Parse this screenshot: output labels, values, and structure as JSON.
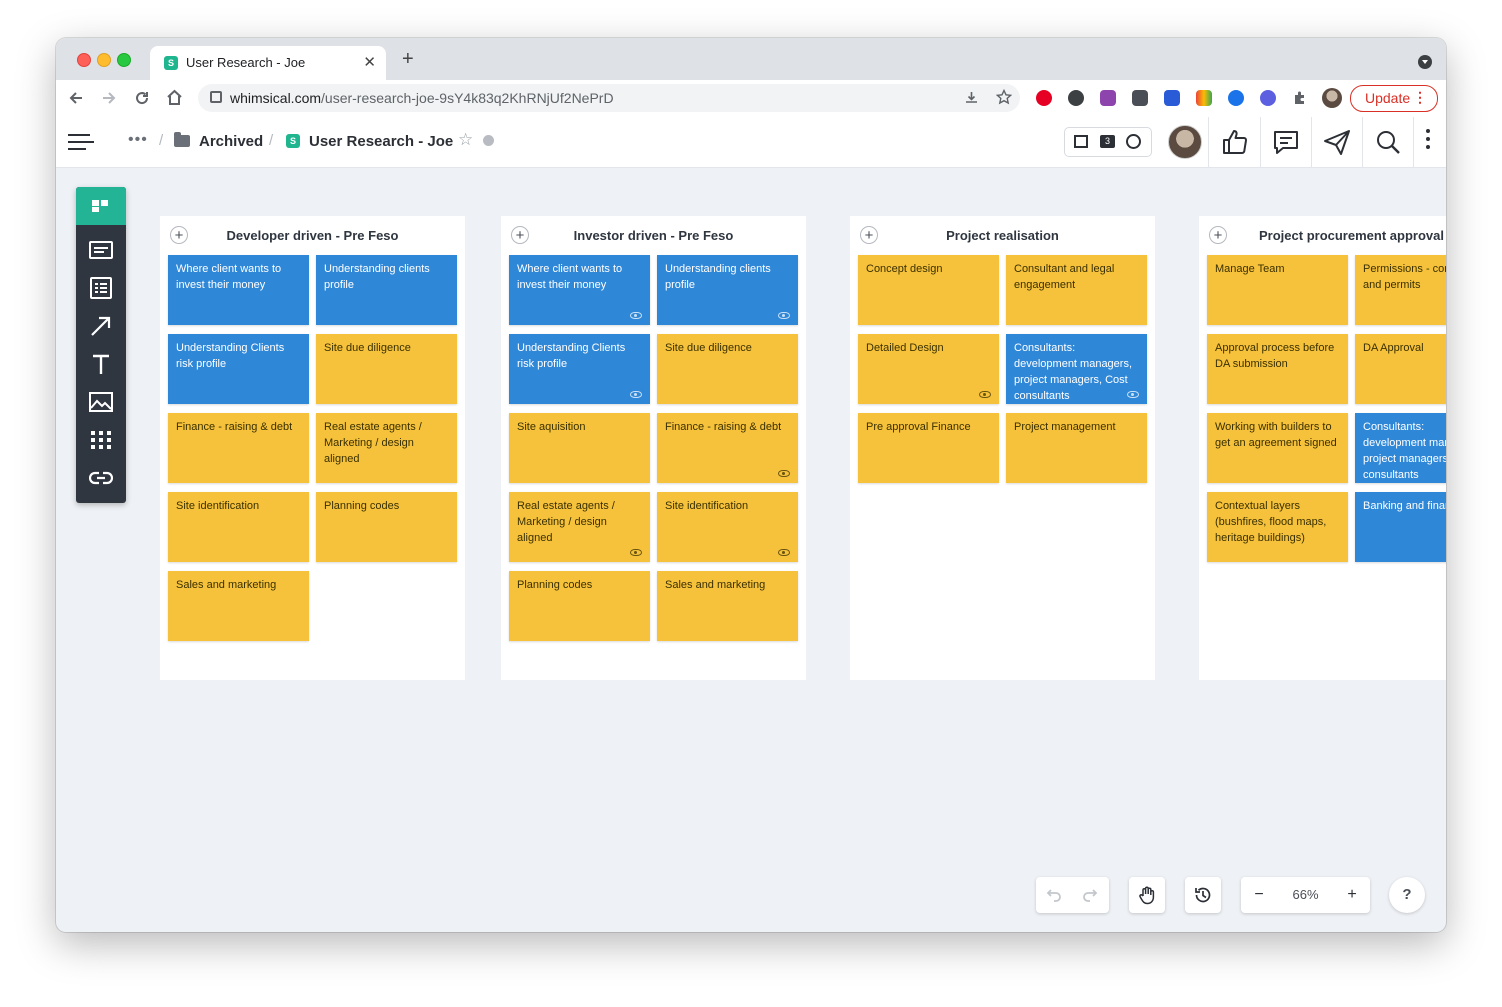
{
  "browser": {
    "tab_title": "User Research - Joe",
    "tab_favicon_letter": "S",
    "close_glyph": "✕",
    "new_tab_glyph": "+",
    "url_domain": "whimsical.com",
    "url_path": "/user-research-joe-9sY4k83q2KhRNjUf2NePrD",
    "update_label": "Update",
    "update_more_glyph": "⋮"
  },
  "header": {
    "more_glyph": "•••",
    "separator": "/",
    "folder_label": "Archived",
    "doc_badge_letter": "S",
    "doc_title": "User Research - Joe",
    "star_glyph": "☆",
    "collaborator_count": "3"
  },
  "boards": [
    {
      "title": "Developer driven - Pre Feso",
      "cards": [
        {
          "text": "Where client wants to invest their money",
          "color": "blue",
          "eye": false
        },
        {
          "text": "Understanding clients profile",
          "color": "blue",
          "eye": false
        },
        {
          "text": "Understanding Clients risk profile",
          "color": "blue",
          "eye": false
        },
        {
          "text": "Site due diligence",
          "color": "yellow",
          "eye": false
        },
        {
          "text": "Finance - raising & debt",
          "color": "yellow",
          "eye": false
        },
        {
          "text": "Real estate agents / Marketing / design aligned",
          "color": "yellow",
          "eye": false
        },
        {
          "text": "Site identification",
          "color": "yellow",
          "eye": false
        },
        {
          "text": "Planning codes",
          "color": "yellow",
          "eye": false
        },
        {
          "text": "Sales and marketing",
          "color": "yellow",
          "eye": false
        }
      ]
    },
    {
      "title": "Investor driven - Pre Feso",
      "cards": [
        {
          "text": "Where client wants to invest their money",
          "color": "blue",
          "eye": true
        },
        {
          "text": "Understanding clients profile",
          "color": "blue",
          "eye": true
        },
        {
          "text": "Understanding Clients risk profile",
          "color": "blue",
          "eye": true
        },
        {
          "text": "Site due diligence",
          "color": "yellow",
          "eye": false
        },
        {
          "text": "Site aquisition",
          "color": "yellow",
          "eye": false
        },
        {
          "text": "Finance - raising & debt",
          "color": "yellow",
          "eye": true
        },
        {
          "text": "Real estate agents / Marketing / design aligned",
          "color": "yellow",
          "eye": true
        },
        {
          "text": "Site identification",
          "color": "yellow",
          "eye": true
        },
        {
          "text": "Planning codes",
          "color": "yellow",
          "eye": false
        },
        {
          "text": "Sales and marketing",
          "color": "yellow",
          "eye": false
        }
      ]
    },
    {
      "title": "Project realisation",
      "cards": [
        {
          "text": "Concept design",
          "color": "yellow",
          "eye": false
        },
        {
          "text": "Consultant and legal engagement",
          "color": "yellow",
          "eye": false
        },
        {
          "text": "Detailed Design",
          "color": "yellow",
          "eye": true
        },
        {
          "text": "Consultants: development managers, project managers, Cost consultants",
          "color": "blue",
          "eye": true
        },
        {
          "text": "Pre approval Finance",
          "color": "yellow",
          "eye": false
        },
        {
          "text": "Project management",
          "color": "yellow",
          "eye": false
        }
      ]
    },
    {
      "title": "Project procurement approval",
      "cards": [
        {
          "text": "Manage Team",
          "color": "yellow",
          "eye": false
        },
        {
          "text": "Permissions - consents and permits",
          "color": "yellow",
          "eye": false
        },
        {
          "text": "Approval process before DA submission",
          "color": "yellow",
          "eye": false
        },
        {
          "text": "DA Approval",
          "color": "yellow",
          "eye": false
        },
        {
          "text": "Working with builders to get an agreement signed",
          "color": "yellow",
          "eye": false
        },
        {
          "text": "Consultants: development managers, project managers, Cost consultants",
          "color": "blue",
          "eye": false
        },
        {
          "text": "Contextual layers (bushfires, flood maps, heritage buildings)",
          "color": "yellow",
          "eye": false
        },
        {
          "text": "Banking and finance",
          "color": "blue",
          "eye": false
        }
      ]
    }
  ],
  "board_add_glyph": "+",
  "zoom": {
    "minus_glyph": "−",
    "level": "66%",
    "plus_glyph": "+"
  },
  "help_glyph": "?",
  "colors": {
    "blue_card": "#2f87d8",
    "yellow_card": "#f6c23c",
    "brand_green": "#23b395",
    "toolbar_dark": "#2f3640"
  },
  "left_tools": [
    "board-icon",
    "card-icon",
    "list-icon",
    "arrow-icon",
    "text-icon",
    "image-icon",
    "grid-icon",
    "link-icon"
  ]
}
